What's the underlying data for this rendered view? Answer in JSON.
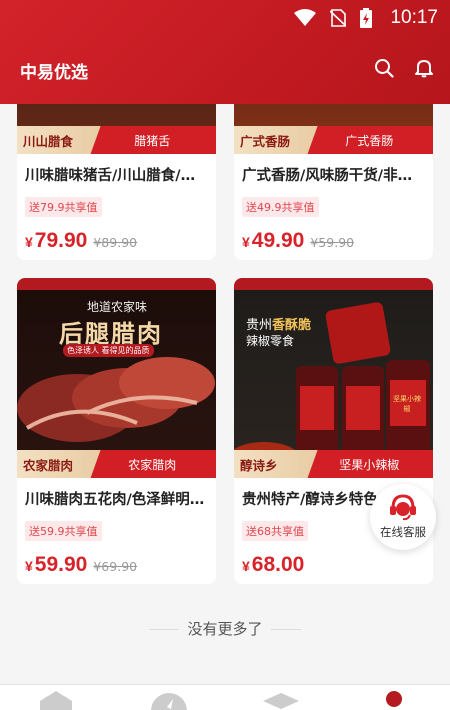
{
  "status": {
    "time": "10:17"
  },
  "header": {
    "title": "中易优选"
  },
  "products": [
    {
      "badge": "川山腊食",
      "sub": "腊猪舌",
      "title": "川味腊味猪舌/川山腊食/…",
      "share": "送79.9共享值",
      "price": "79.90",
      "original": "¥89.90",
      "yen": "¥"
    },
    {
      "badge": "广式香肠",
      "sub": "广式香肠",
      "title": "广式香肠/风味肠干货/非…",
      "share": "送49.9共享值",
      "price": "49.90",
      "original": "¥59.90",
      "yen": "¥"
    },
    {
      "badge": "农家腊肉",
      "sub": "农家腊肉",
      "title": "川味腊肉五花肉/色泽鲜明…",
      "share": "送59.9共享值",
      "price": "59.90",
      "original": "¥69.90",
      "yen": "¥",
      "image_text": {
        "line1": "地道农家味",
        "line2": "后腿腊肉",
        "line3": "色泽诱人 看得见的品质"
      }
    },
    {
      "badge": "醇诗乡",
      "sub": "坚果小辣椒",
      "title": "贵州特产/醇诗乡特色…",
      "share": "送68共享值",
      "price": "68.00",
      "original": "",
      "yen": "¥",
      "image_text": {
        "line1": "贵州",
        "line1b": "香酥脆",
        "line2": "辣椒零食",
        "jar": "坚果小辣椒"
      }
    }
  ],
  "customer_service": {
    "label": "在线客服"
  },
  "footer": {
    "no_more": "没有更多了"
  },
  "colors": {
    "brand_red": "#d21f26",
    "price_red": "#d8232a"
  }
}
